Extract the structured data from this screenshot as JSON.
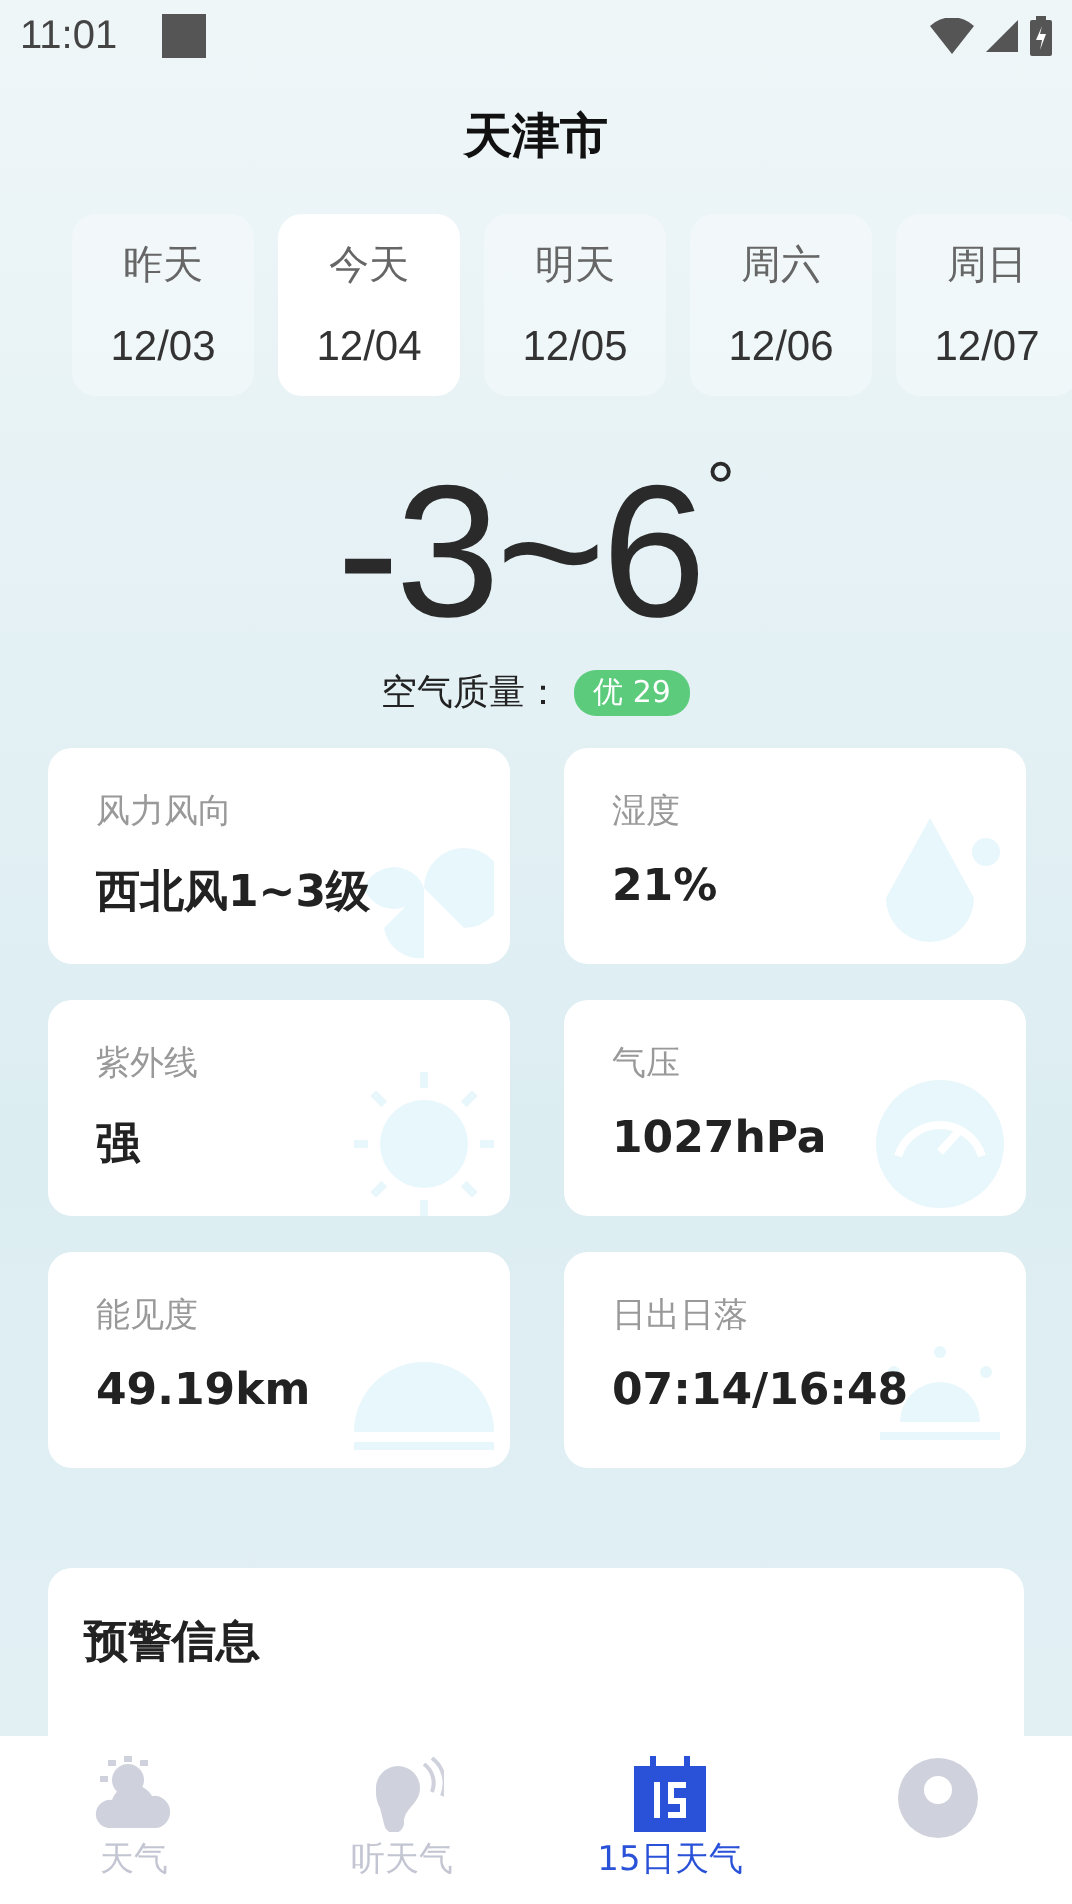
{
  "status_bar": {
    "time": "11:01"
  },
  "city": "天津市",
  "days": [
    {
      "label": "昨天",
      "date": "12/03",
      "selected": false
    },
    {
      "label": "今天",
      "date": "12/04",
      "selected": true
    },
    {
      "label": "明天",
      "date": "12/05",
      "selected": false
    },
    {
      "label": "周六",
      "date": "12/06",
      "selected": false
    },
    {
      "label": "周日",
      "date": "12/07",
      "selected": false
    }
  ],
  "temperature": {
    "range": "-3~6",
    "unit": "°"
  },
  "air_quality": {
    "label": "空气质量：",
    "badge": "优 29"
  },
  "details": [
    {
      "kind": "wind",
      "label": "风力风向",
      "value": "西北风1~3级"
    },
    {
      "kind": "humidity",
      "label": "湿度",
      "value": "21%"
    },
    {
      "kind": "uv",
      "label": "紫外线",
      "value": "强"
    },
    {
      "kind": "pressure",
      "label": "气压",
      "value": "1027hPa"
    },
    {
      "kind": "visibility",
      "label": "能见度",
      "value": "49.19km"
    },
    {
      "kind": "sun",
      "label": "日出日落",
      "value": "07:14/16:48"
    }
  ],
  "warning": {
    "title": "预警信息"
  },
  "nav": [
    {
      "kind": "weather",
      "label": "天气",
      "selected": false
    },
    {
      "kind": "listen",
      "label": "听天气",
      "selected": false
    },
    {
      "kind": "calendar",
      "label": "15日天气",
      "selected": true
    },
    {
      "kind": "profile",
      "selected": false
    }
  ]
}
